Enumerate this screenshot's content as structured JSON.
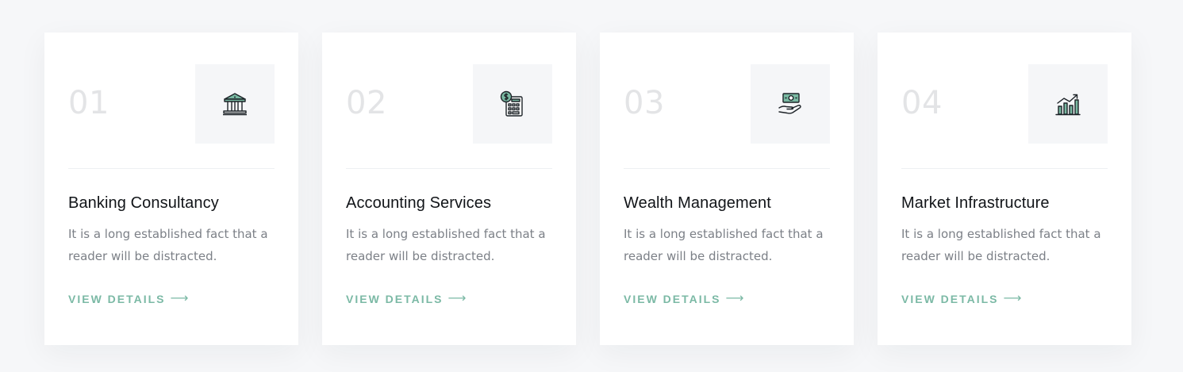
{
  "colors": {
    "accent": "#7bb9a5",
    "icon_fill": "#79b9a2",
    "icon_stroke": "#1d2328",
    "number": "#e3e4e6",
    "title": "#111418",
    "body": "#7c8087",
    "card_bg": "#ffffff",
    "page_bg": "#f6f7f9",
    "icon_box_bg": "#f5f6f8"
  },
  "services": [
    {
      "number": "01",
      "icon": "bank-icon",
      "title": "Banking Consultancy",
      "description": "It is a long established fact that a reader will be distracted.",
      "link_label": "VIEW DETAILS",
      "arrow": "⟶"
    },
    {
      "number": "02",
      "icon": "calculator-icon",
      "title": "Accounting Services",
      "description": "It is a long established fact that a reader will be distracted.",
      "link_label": "VIEW DETAILS",
      "arrow": "⟶"
    },
    {
      "number": "03",
      "icon": "money-hand-icon",
      "title": "Wealth Management",
      "description": "It is a long established fact that a reader will be distracted.",
      "link_label": "VIEW DETAILS",
      "arrow": "⟶"
    },
    {
      "number": "04",
      "icon": "growth-chart-icon",
      "title": "Market Infrastructure",
      "description": "It is a long established fact that a reader will be distracted.",
      "link_label": "VIEW DETAILS",
      "arrow": "⟶"
    }
  ]
}
